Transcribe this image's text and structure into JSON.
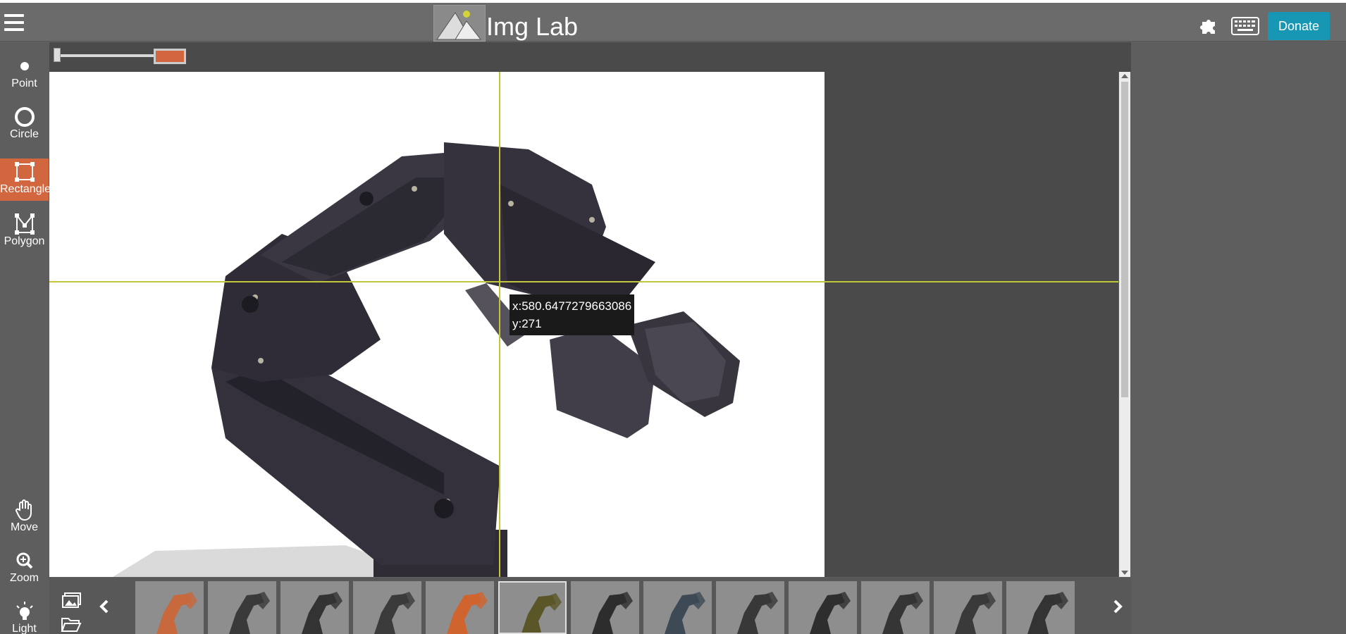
{
  "header": {
    "app_title": "Img Lab",
    "donate_label": "Donate",
    "icons": [
      "hamburger-menu-icon",
      "img-lab-logo",
      "puzzle-icon",
      "keyboard-icon"
    ]
  },
  "toolbar": {
    "tools": [
      {
        "label": "Point",
        "icon": "point-icon"
      },
      {
        "label": "Circle",
        "icon": "circle-icon"
      },
      {
        "label": "Rectangle",
        "icon": "rectangle-icon",
        "active": true
      },
      {
        "label": "Polygon",
        "icon": "polygon-icon"
      }
    ],
    "bottom_tools": [
      {
        "label": "Move",
        "icon": "hand-icon"
      },
      {
        "label": "Zoom",
        "icon": "zoom-icon"
      },
      {
        "label": "Light",
        "icon": "lightbulb-icon"
      }
    ]
  },
  "canvas": {
    "coord_x": "x:580.6477279663086",
    "coord_y": "y:271",
    "subject": "robotic-arm-image"
  },
  "colors": {
    "accent": "#d1663f",
    "donate": "#1797b4",
    "crosshair": "#c3c63a",
    "background": "#5e5e5e"
  },
  "thumbnails": {
    "count": 13,
    "selected_index": 5
  }
}
